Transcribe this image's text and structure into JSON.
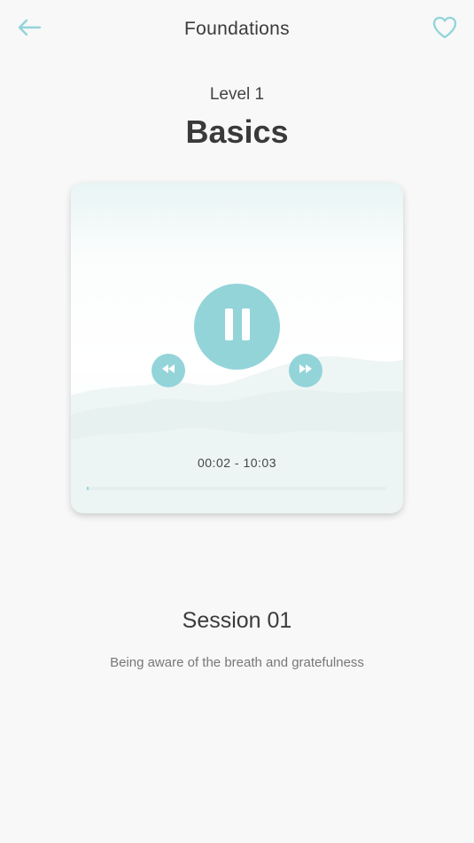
{
  "header": {
    "title": "Foundations",
    "back_icon": "arrow-left-icon",
    "favorite_icon": "heart-outline-icon"
  },
  "course": {
    "level": "Level 1",
    "title": "Basics"
  },
  "player": {
    "state": "playing",
    "play_pause_icon": "pause-icon",
    "rewind_icon": "rewind-icon",
    "forward_icon": "fast-forward-icon",
    "time_display": "00:02 - 10:03",
    "progress_fraction": 0.003
  },
  "session": {
    "title": "Session 01",
    "description": "Being aware of the breath and gratefulness"
  },
  "colors": {
    "accent": "#93d4d9",
    "background": "#f8f8f8",
    "text_dark": "#3b3b3b",
    "text_muted": "#777777"
  }
}
